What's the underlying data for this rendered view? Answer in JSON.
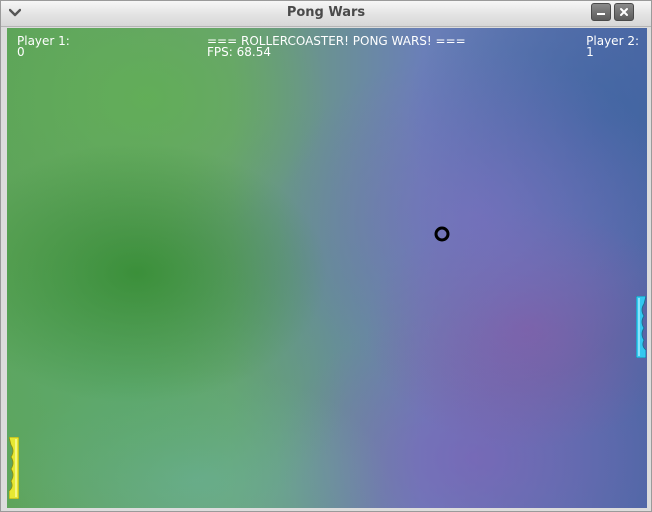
{
  "window": {
    "title": "Pong Wars",
    "menu_icon": "chevron-down-icon",
    "minimize_icon": "minimize-icon",
    "close_icon": "close-icon"
  },
  "hud": {
    "player1_label": "Player 1:",
    "player1_score": "0",
    "player2_label": "Player 2:",
    "player2_score": "1",
    "banner": "=== ROLLERCOASTER! PONG WARS! ===",
    "fps": "FPS: 68.54"
  },
  "colors": {
    "left_paddle": "#e6e832",
    "right_paddle": "#33c7f0",
    "ball": "#000000",
    "hud_text": "#ffffff"
  }
}
